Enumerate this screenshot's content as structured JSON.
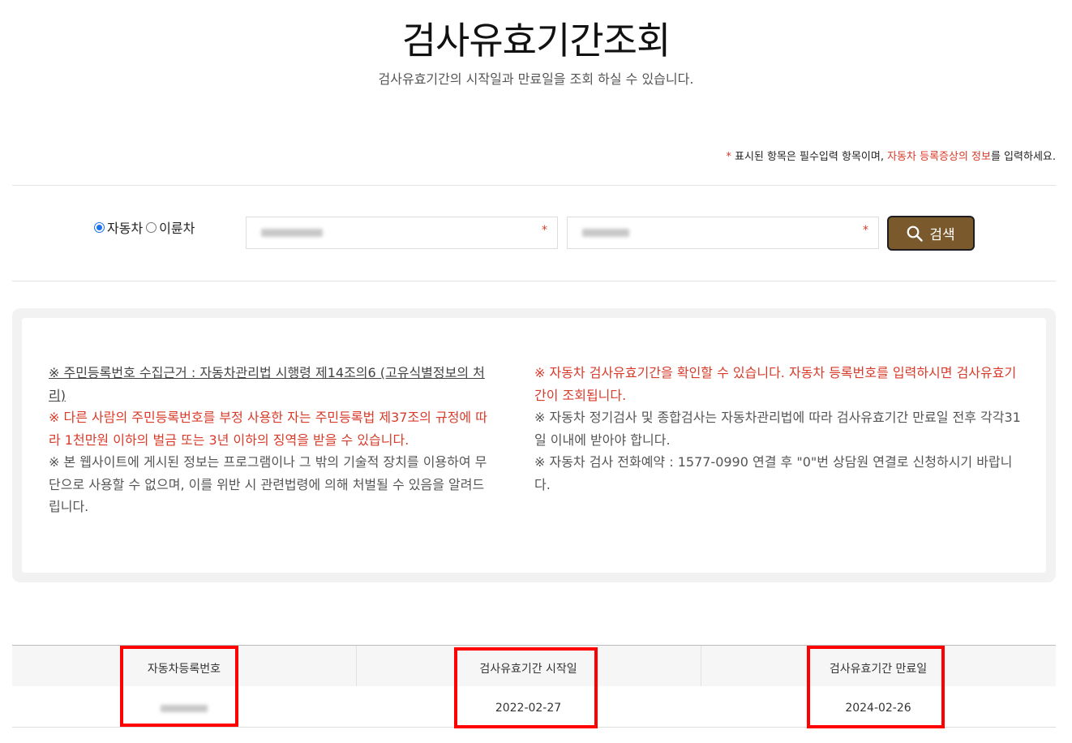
{
  "header": {
    "title": "검사유효기간조회",
    "subtitle": "검사유효기간의 시작일과 만료일을 조회 하실 수 있습니다."
  },
  "notice": {
    "star": "*",
    "part1": " 표시된 항목은 필수입력 항목이며, ",
    "highlight": "자동차 등록증상의 정보",
    "part2": "를 입력하세요."
  },
  "search": {
    "radio_car": "자동차",
    "radio_moto": "이륜차",
    "selected": "자동차",
    "field1_star": "*",
    "field2_star": "*",
    "button_label": "검색",
    "icon": "search-icon"
  },
  "info": {
    "left": [
      "※ 주민등록번호 수집근거 : 자동차관리법 시행령 제14조의6 (고유식별정보의 처리)",
      "※ 다른 사람의 주민등록번호를 부정 사용한 자는 주민등록법 제37조의 규정에 따라 1천만원 이하의 벌금 또는 3년 이하의 징역을 받을 수 있습니다.",
      "※ 본 웹사이트에 게시된 정보는 프로그램이나 그 밖의 기술적 장치를 이용하여 무단으로 사용할 수 없으며, 이를 위반 시 관련법령에 의해 처벌될 수 있음을 알려드립니다."
    ],
    "right": [
      "※ 자동차 검사유효기간을 확인할 수 있습니다. 자동차 등록번호를 입력하시면 검사유효기간이 조회됩니다.",
      "※ 자동차 정기검사 및 종합검사는 자동차관리법에 따라 검사유효기간 만료일 전후 각각31일 이내에 받아야 합니다.",
      "※ 자동차 검사 전화예약 : 1577-0990 연결 후 \"0\"번 상담원 연결로 신청하시기 바랍니다."
    ]
  },
  "result": {
    "headers": [
      "자동차등록번호",
      "검사유효기간 시작일",
      "검사유효기간 만료일"
    ],
    "row": {
      "start_date": "2022-02-27",
      "end_date": "2024-02-26"
    }
  },
  "colors": {
    "accent_red": "#d83b2a",
    "button_brown": "#7a5a2c",
    "highlight_box": "#ff0000"
  }
}
